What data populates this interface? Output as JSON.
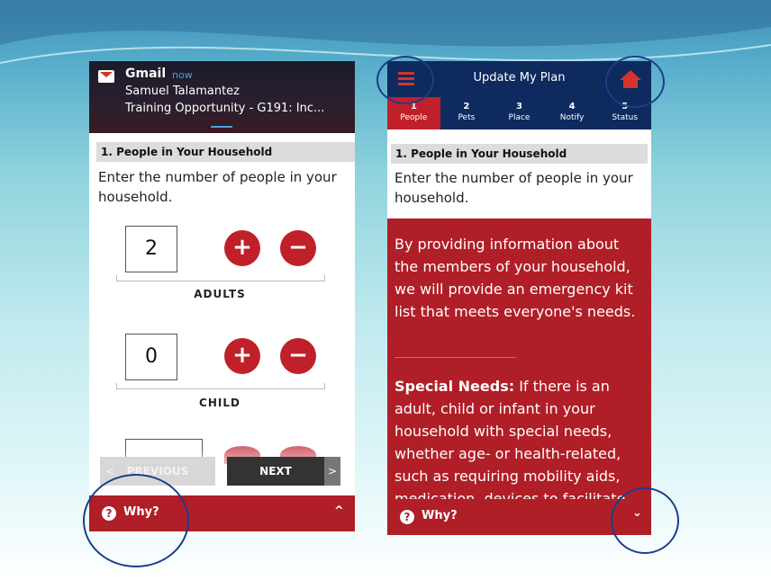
{
  "colors": {
    "brand_red": "#b01e27",
    "navy": "#0e2a5e",
    "prev_gray": "#d7d7d7",
    "next_dark": "#333333"
  },
  "left_screen": {
    "notification": {
      "app": "Gmail",
      "time": "now",
      "sender": "Samuel Talamantez",
      "subject": "Training Opportunity - G191: Inc...",
      "icon": "gmail-icon"
    },
    "section_title": "1. People in Your Household",
    "intro": "Enter the number of people in your household.",
    "counters": [
      {
        "label": "ADULTS",
        "value": "2"
      },
      {
        "label": "CHILD",
        "value": "0"
      }
    ],
    "plus_symbol": "+",
    "minus_symbol": "−",
    "prev_label": "PREVIOUS",
    "prev_arrow": "<",
    "next_label": "NEXT",
    "next_arrow": ">",
    "why_label": "Why?",
    "why_icon": "?",
    "why_chevron": "^"
  },
  "right_screen": {
    "title": "Update My Plan",
    "steps": [
      {
        "num": "1",
        "label": "People"
      },
      {
        "num": "2",
        "label": "Pets"
      },
      {
        "num": "3",
        "label": "Place"
      },
      {
        "num": "4",
        "label": "Notify"
      },
      {
        "num": "5",
        "label": "Status"
      }
    ],
    "section_title": "1. People in Your Household",
    "intro": "Enter the number of people in your household.",
    "info_paragraph": "By providing information about the members of your household, we will provide an emergency kit list that meets everyone's needs.",
    "special_needs_label": "Special Needs:",
    "special_needs_text": " If there is an adult, child or infant in your household with special needs, whether age- or health-related, such as requiring mobility aids, medication, devices to facilitate",
    "why_label": "Why?",
    "why_icon": "?",
    "why_chevron": "⌄"
  }
}
